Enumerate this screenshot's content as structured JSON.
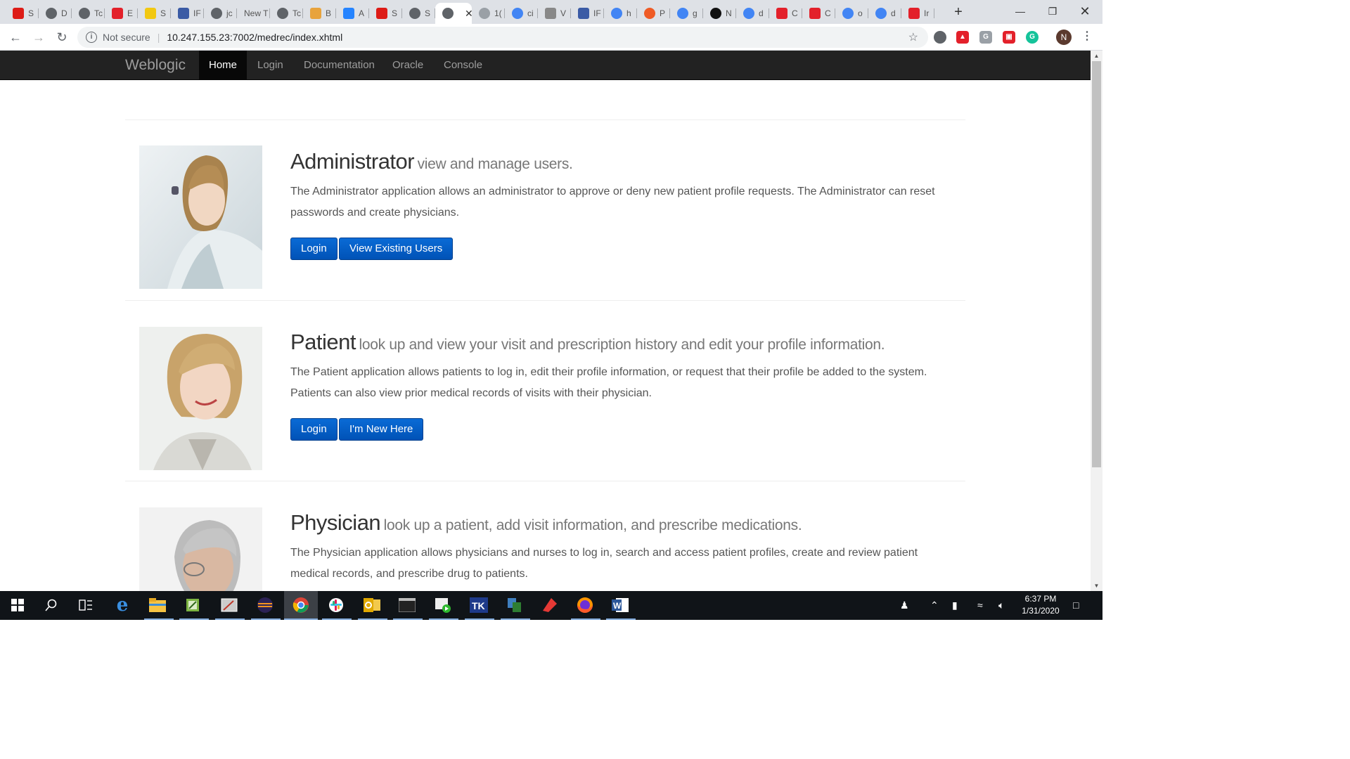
{
  "browser": {
    "tabs": [
      {
        "label": "S",
        "icon": "angular-icon",
        "color": "#dd1b16"
      },
      {
        "label": "D",
        "icon": "globe-icon",
        "color": "#5f6368"
      },
      {
        "label": "Tc",
        "icon": "globe-icon",
        "color": "#5f6368"
      },
      {
        "label": "E",
        "icon": "oracle-icon",
        "color": "#e3202a"
      },
      {
        "label": "S",
        "icon": "app-icon",
        "color": "#f2c811"
      },
      {
        "label": "IF",
        "icon": "ifs-icon",
        "color": "#3b5ba5"
      },
      {
        "label": "jc",
        "icon": "globe-icon",
        "color": "#5f6368"
      },
      {
        "label": "New T",
        "icon": "",
        "color": ""
      },
      {
        "label": "Tc",
        "icon": "globe-icon",
        "color": "#5f6368"
      },
      {
        "label": "B",
        "icon": "bitbucket-icon",
        "color": "#e8a33c"
      },
      {
        "label": "A",
        "icon": "confluence-icon",
        "color": "#2684ff"
      },
      {
        "label": "S",
        "icon": "angular-icon",
        "color": "#dd1b16"
      },
      {
        "label": "S",
        "icon": "globe-icon",
        "color": "#5f6368"
      },
      {
        "label": "",
        "icon": "globe-icon",
        "color": "#5f6368"
      },
      {
        "label": "1(",
        "icon": "globe-icon",
        "color": "#9aa0a6"
      },
      {
        "label": "ci",
        "icon": "google-icon",
        "color": "#4285f4"
      },
      {
        "label": "V",
        "icon": "bc-icon",
        "color": "#888888"
      },
      {
        "label": "IF",
        "icon": "ifs-icon",
        "color": "#3b5ba5"
      },
      {
        "label": "h",
        "icon": "google-icon",
        "color": "#4285f4"
      },
      {
        "label": "P",
        "icon": "postman-icon",
        "color": "#ef5b25"
      },
      {
        "label": "g",
        "icon": "google-icon",
        "color": "#4285f4"
      },
      {
        "label": "N",
        "icon": "github-icon",
        "color": "#111111"
      },
      {
        "label": "d",
        "icon": "google-icon",
        "color": "#4285f4"
      },
      {
        "label": "C",
        "icon": "oracle-ring-icon",
        "color": "#e3202a"
      },
      {
        "label": "C",
        "icon": "oracle-icon",
        "color": "#e3202a"
      },
      {
        "label": "o",
        "icon": "google-icon",
        "color": "#4285f4"
      },
      {
        "label": "d",
        "icon": "google-icon",
        "color": "#4285f4"
      },
      {
        "label": "Ir",
        "icon": "oracle-ring-icon",
        "color": "#e3202a"
      }
    ],
    "url_security": "Not secure",
    "url": "10.247.155.23:7002/medrec/index.xhtml",
    "profile_initial": "N"
  },
  "site": {
    "brand": "Weblogic",
    "nav": [
      {
        "label": "Home",
        "active": true
      },
      {
        "label": "Login",
        "active": false
      },
      {
        "label": "Documentation",
        "active": false
      },
      {
        "label": "Oracle",
        "active": false
      },
      {
        "label": "Console",
        "active": false
      }
    ]
  },
  "roles": [
    {
      "title": "Administrator",
      "subtitle": "view and manage users.",
      "description": "The Administrator application allows an administrator to approve or deny new patient profile requests. The Administrator can reset passwords and create physicians.",
      "buttons": [
        "Login",
        "View Existing Users"
      ]
    },
    {
      "title": "Patient",
      "subtitle": "look up and view your visit and prescription history and edit your profile information.",
      "description": "The Patient application allows patients to log in, edit their profile information, or request that their profile be added to the system. Patients can also view prior medical records of visits with their physician.",
      "buttons": [
        "Login",
        "I'm New Here"
      ]
    },
    {
      "title": "Physician",
      "subtitle": "look up a patient, add visit information, and prescribe medications.",
      "description": "The Physician application allows physicians and nurses to log in, search and access patient profiles, create and review patient medical records, and prescribe drug to patients.",
      "buttons": []
    }
  ],
  "taskbar": {
    "time": "6:37 PM",
    "date": "1/31/2020"
  },
  "colors": {
    "navbar": "#222222",
    "primary_button": "#0a6bd6",
    "taskbar": "#101418"
  }
}
